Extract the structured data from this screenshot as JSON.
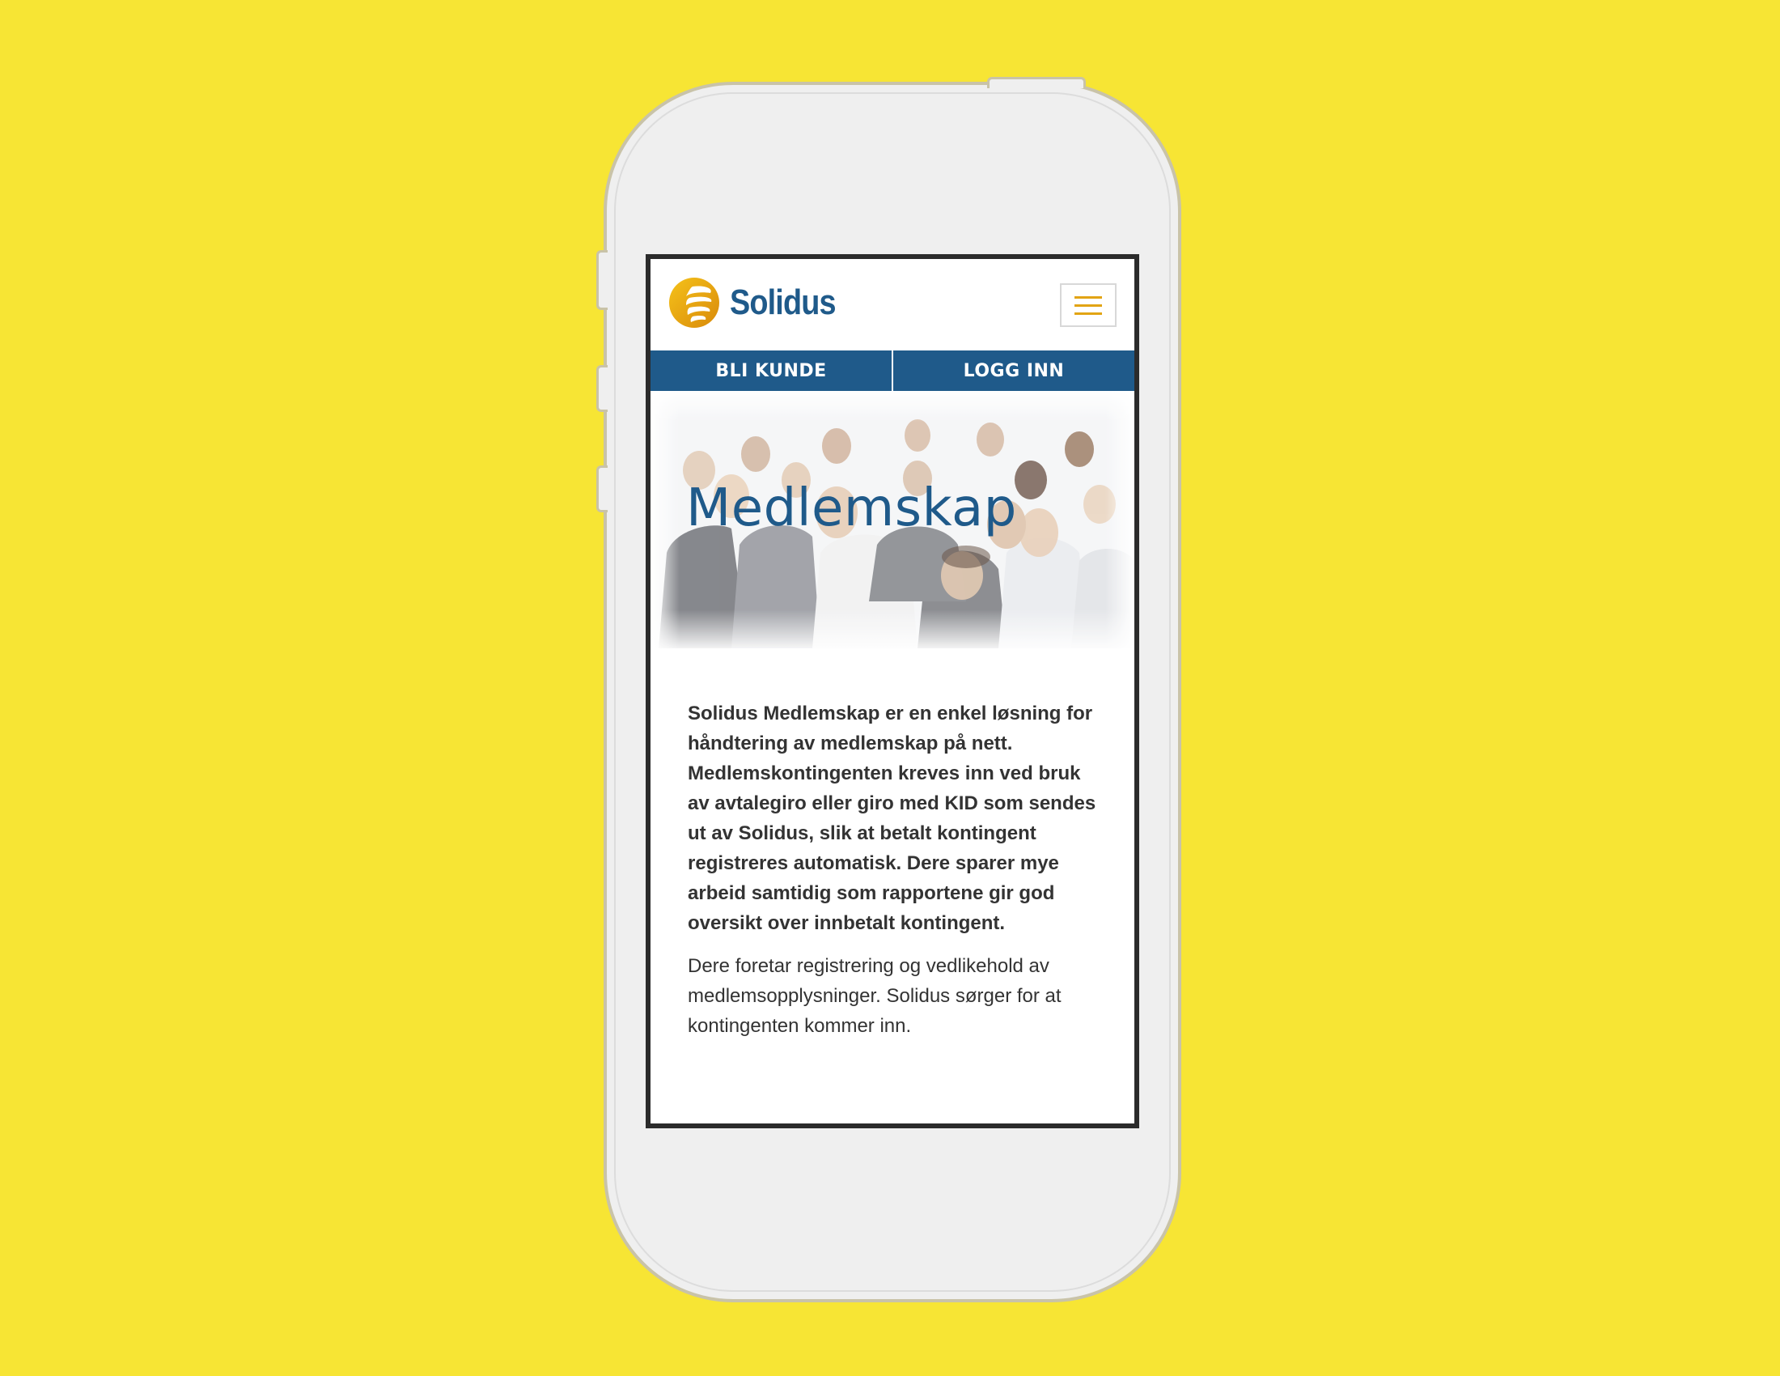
{
  "brand": {
    "name": "Solidus",
    "accent": "#e2a414",
    "primary": "#1f5a8a",
    "background": "#f7e534"
  },
  "header": {
    "menu_icon": "hamburger-icon"
  },
  "nav": {
    "items": [
      {
        "label": "BLI KUNDE"
      },
      {
        "label": "LOGG INN"
      }
    ]
  },
  "hero": {
    "title": "Medlemskap"
  },
  "content": {
    "lead": "Solidus Medlemskap er en enkel løsning for håndtering av medlemskap på nett. Medlemskontingenten kreves inn ved bruk av avtalegiro eller giro med KID som sendes ut av Solidus, slik at betalt kontingent registreres automatisk. Dere sparer mye arbeid samtidig som rapportene gir god oversikt over innbetalt kontingent.",
    "body": "Dere foretar registrering og vedlikehold av medlemsopplysninger. Solidus sørger for at kontingenten kommer inn."
  }
}
